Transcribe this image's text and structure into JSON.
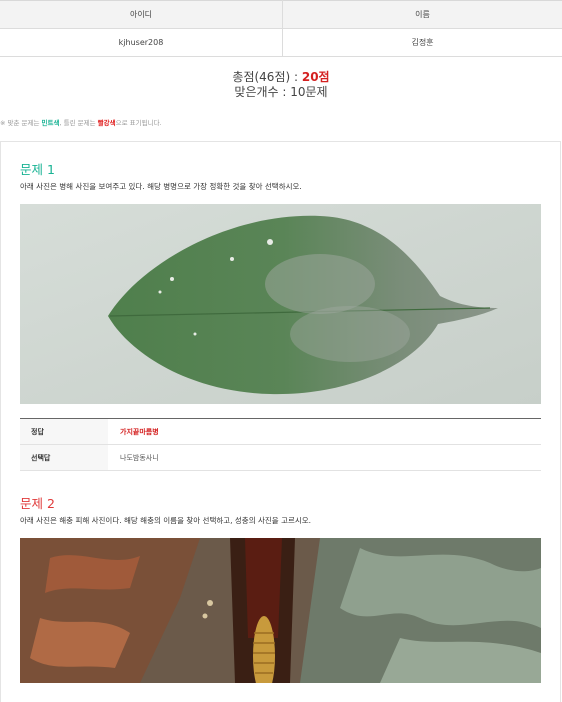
{
  "user_table": {
    "headers": [
      "아이디",
      "이름"
    ],
    "row": [
      "kjhuser208",
      "김정훈"
    ]
  },
  "score": {
    "prefix": "총점(46점) : ",
    "points": "20점",
    "correct_count": "맞은개수 : 10문제"
  },
  "notice": {
    "part1": "※ 맞춘 문제는 ",
    "mint_label": "민트색",
    "part2": ", 틀린 문제는 ",
    "red_label": "빨강색",
    "part3": "으로 표기됩니다."
  },
  "questions": [
    {
      "title": "문제 1",
      "status": "correct",
      "text": "아래 사진은 병해 사진을 보여주고 있다. 해당 병명으로 가장 정확한 것을 찾아 선택하시오.",
      "image_icon": "diseased-leaf-photo",
      "answer_label": "정답",
      "answer_value": "가지끝마름병",
      "selected_label": "선택답",
      "selected_value": "나도밤동사니"
    },
    {
      "title": "문제 2",
      "status": "wrong",
      "text": "아래 사진은 해충 피해 사진이다. 해당 해충의 이름을 찾아 선택하고, 성충의 사진을 고르시오.",
      "image_icon": "tree-bark-larva-photo"
    }
  ],
  "colors": {
    "correct": "#19b394",
    "wrong": "#e03a3a",
    "answer": "#d42020"
  }
}
